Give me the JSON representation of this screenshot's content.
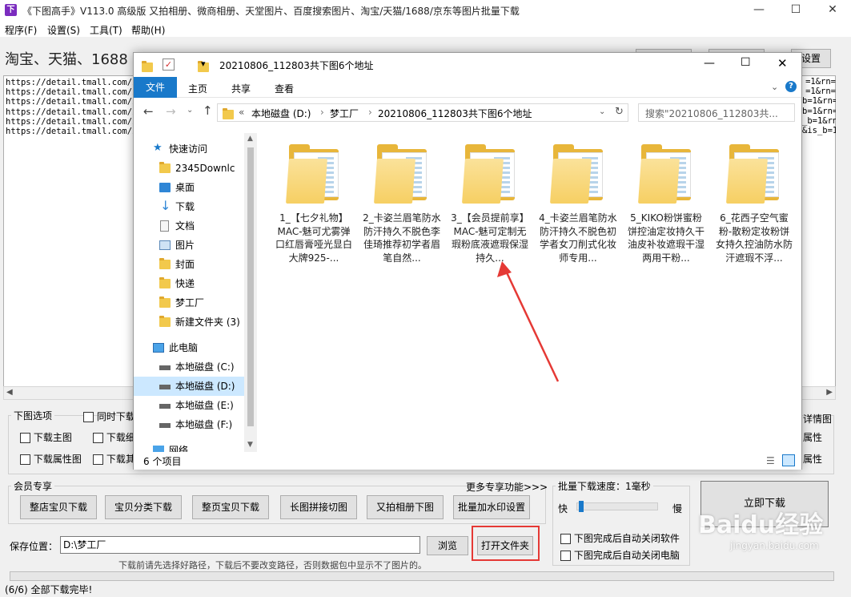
{
  "app": {
    "title": "《下图高手》V113.0  高级版   又拍相册、微商相册、天堂图片、百度搜索图片、淘宝/天猫/1688/京东等图片批量下载",
    "icon": "app-logo-icon"
  },
  "menu": [
    "程序(F)",
    "设置(S)",
    "工具(T)",
    "帮助(H)"
  ],
  "headline": "淘宝、天猫、1688",
  "header_buttons": {
    "settings": "设置"
  },
  "url_lines": [
    "https://detail.tmall.com/i",
    "https://detail.tmall.com/i",
    "https://detail.tmall.com/i",
    "https://detail.tmall.com/i",
    "https://detail.tmall.com/i",
    "https://detail.tmall.com/i"
  ],
  "url_tails": [
    "=1&rn=",
    "=1&rn=",
    "b=1&rn=",
    "b=1&rn=",
    "_b=1&rn=",
    "&is_b=1"
  ],
  "download_options": {
    "legend": "下图选项",
    "same_time": "同时下载",
    "main_image": "下载主图",
    "detail_short": "下载细",
    "attr_image": "下载属性图",
    "more_short": "下载其",
    "detail_right": "详情图",
    "attr_right1": "属性",
    "attr_right2": "属性"
  },
  "member": {
    "legend": "会员专享",
    "more": "更多专享功能>>>",
    "buttons": [
      "整店宝贝下载",
      "宝贝分类下载",
      "整页宝贝下载",
      "长图拼接切图",
      "又拍相册下图",
      "批量加水印设置"
    ]
  },
  "speed": {
    "legend": "批量下载速度：1毫秒",
    "fast": "快",
    "slow": "慢",
    "slider_value": 0.02,
    "auto_close_app": "下图完成后自动关闭软件",
    "auto_shutdown": "下图完成后自动关闭电脑"
  },
  "download_now": "立即下载",
  "save": {
    "label": "保存位置：",
    "value": "D:\\梦工厂",
    "browse": "浏览",
    "open_folder": "打开文件夹",
    "hint": "下载前请先选择好路径，下载后不要改变路径，否则数据包中显示不了图片的。"
  },
  "status": "(6/6) 全部下载完毕!",
  "explorer": {
    "title": "20210806_112803共下图6个地址",
    "ribbon_tabs": [
      "文件",
      "主页",
      "共享",
      "查看"
    ],
    "breadcrumb": [
      "本地磁盘 (D:)",
      "梦工厂",
      "20210806_112803共下图6个地址"
    ],
    "breadcrumb_prefix": "«",
    "search_placeholder": "搜索\"20210806_112803共...",
    "nav": {
      "quick_access": "快速访问",
      "items": [
        "2345Downlc",
        "桌面",
        "下载",
        "文档",
        "图片",
        "封面",
        "快递",
        "梦工厂",
        "新建文件夹 (3)"
      ],
      "this_pc": "此电脑",
      "drives": [
        "本地磁盘 (C:)",
        "本地磁盘 (D:)",
        "本地磁盘 (E:)",
        "本地磁盘 (F:)"
      ],
      "network": "网络"
    },
    "folders": [
      "1_【七夕礼物】MAC-魅可尤雾弹口红唇膏哑光显白大牌925-...",
      "2_卡姿兰眉笔防水防汗持久不脱色李佳琦推荐初学者眉笔自然...",
      "3_【会员提前享】MAC-魅可定制无瑕粉底液遮瑕保湿持久...",
      "4_卡姿兰眉笔防水防汗持久不脱色初学者女刀削式化妆师专用...",
      "5_KIKO粉饼蜜粉饼控油定妆持久干油皮补妆遮瑕干湿两用干粉...",
      "6_花西子空气蜜粉-散粉定妆粉饼女持久控油防水防汗遮瑕不浮..."
    ],
    "item_count": "6 个项目"
  },
  "watermark": {
    "brand": "Baidu经验",
    "url": "jingyan.baidu.com"
  },
  "colors": {
    "accent": "#1979ca",
    "highlight": "#e53935",
    "folder": "#f6cf63"
  }
}
